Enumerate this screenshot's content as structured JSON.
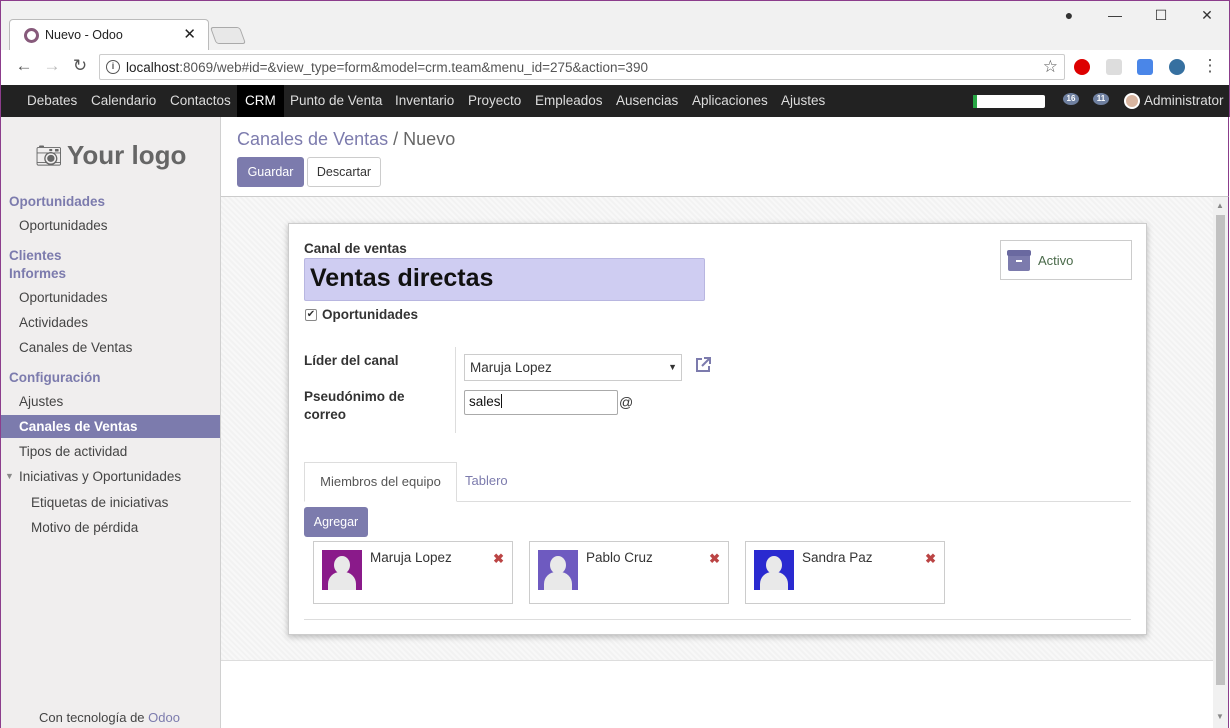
{
  "browser": {
    "tab_title": "Nuevo - Odoo",
    "tab_close": "✕",
    "url_host": "localhost",
    "url_rest": ":8069/web#id=&view_type=form&model=crm.team&menu_id=275&action=390"
  },
  "topmenu": {
    "items": [
      "Debates",
      "Calendario",
      "Contactos",
      "CRM",
      "Punto de Venta",
      "Inventario",
      "Proyecto",
      "Empleados",
      "Ausencias",
      "Aplicaciones",
      "Ajustes"
    ],
    "active": "CRM",
    "activity_count": "16",
    "message_count": "11",
    "user": "Administrator",
    "progress": 0.05
  },
  "sidebar": {
    "logo_text": "Your logo",
    "sections": {
      "oportunidades_head": "Oportunidades",
      "oportunidades_item": "Oportunidades",
      "clientes_head": "Clientes",
      "informes_head": "Informes",
      "informes_items": [
        "Oportunidades",
        "Actividades",
        "Canales de Ventas"
      ],
      "config_head": "Configuración",
      "config_items": [
        "Ajustes",
        "Canales de Ventas",
        "Tipos de actividad",
        "Iniciativas y Oportunidades",
        "Etiquetas de iniciativas",
        "Motivo de pérdida"
      ]
    },
    "powered_prefix": "Con tecnología de ",
    "powered_brand": "Odoo"
  },
  "control_panel": {
    "breadcrumb_parent": "Canales de Ventas",
    "breadcrumb_sep": "/",
    "breadcrumb_current": "Nuevo",
    "save_label": "Guardar",
    "discard_label": "Descartar"
  },
  "form": {
    "name_label": "Canal de ventas",
    "name_value": "Ventas directas",
    "opportunities_checked": true,
    "opportunities_label": "Oportunidades",
    "active_label": "Activo",
    "leader_label": "Líder del canal",
    "leader_value": "Maruja Lopez",
    "alias_label_1": "Pseudónimo de",
    "alias_label_2": "correo",
    "alias_value": "sales",
    "alias_suffix": "@",
    "tabs": [
      "Miembros del equipo",
      "Tablero"
    ],
    "add_label": "Agregar",
    "members": [
      {
        "name": "Maruja Lopez",
        "color": "#8a1a8a"
      },
      {
        "name": "Pablo Cruz",
        "color": "#6e5ac0"
      },
      {
        "name": "Sandra Paz",
        "color": "#2a2ad0"
      }
    ]
  },
  "colors": {
    "accent": "#7c7bad",
    "topbar": "#222222"
  }
}
